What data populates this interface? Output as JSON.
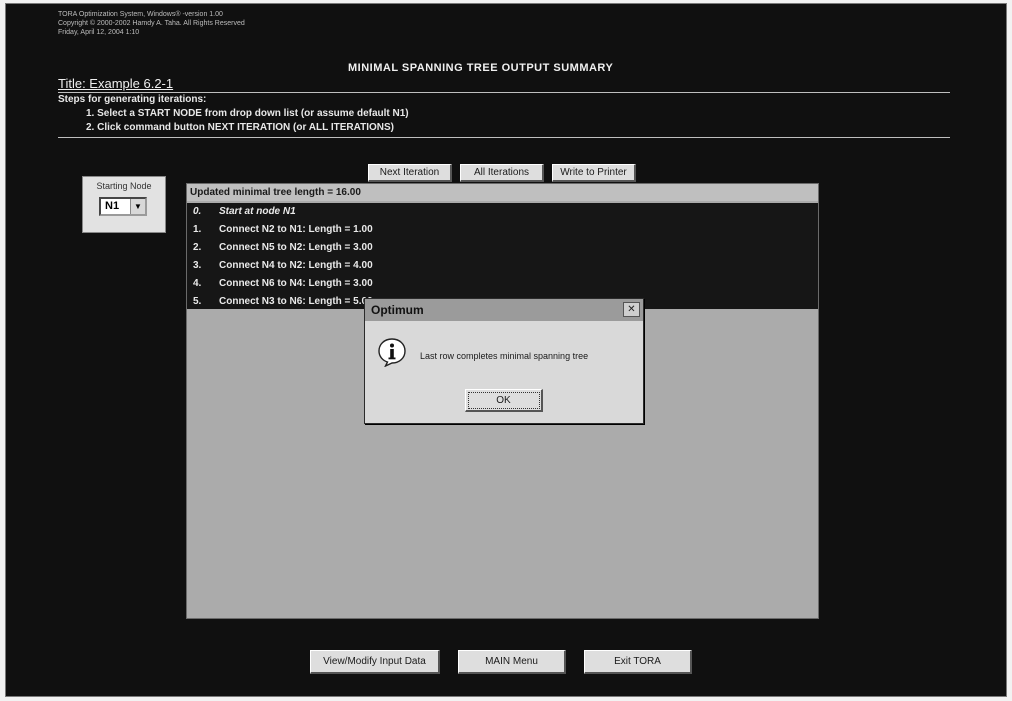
{
  "window": {
    "copyright_lines": [
      "TORA Optimization System, Windows® -version 1.00",
      "Copyright © 2000-2002 Hamdy A. Taha. All Rights Reserved",
      "Friday, April 12, 2004  1:10"
    ],
    "main_title": "MINIMAL SPANNING TREE OUTPUT SUMMARY",
    "title_line": "Title: Example 6.2-1"
  },
  "instructions": {
    "heading": "Steps for generating iterations:",
    "steps": [
      "1.  Select a START NODE from drop down list (or assume default N1)",
      "2.  Click command button NEXT ITERATION (or ALL ITERATIONS)"
    ]
  },
  "toolbar": {
    "next_iteration": "Next Iteration",
    "all_iterations": "All Iterations",
    "write_to_printer": "Write to Printer"
  },
  "starting_node": {
    "label": "Starting Node",
    "selected": "N1"
  },
  "results": {
    "header": "Updated minimal tree length = 16.00",
    "rows": [
      {
        "num": "0.",
        "text": "Start at node N1"
      },
      {
        "num": "1.",
        "text": "Connect N2 to N1: Length = 1.00"
      },
      {
        "num": "2.",
        "text": "Connect N5 to N2: Length = 3.00"
      },
      {
        "num": "3.",
        "text": "Connect N4 to N2: Length = 4.00"
      },
      {
        "num": "4.",
        "text": "Connect N6 to N4: Length = 3.00"
      },
      {
        "num": "5.",
        "text": "Connect N3 to N6: Length = 5.00"
      }
    ]
  },
  "dialog": {
    "title": "Optimum",
    "close": "✕",
    "message": "Last row completes minimal spanning tree",
    "ok": "OK",
    "icon": "info-icon"
  },
  "bottom_buttons": {
    "view_modify": "View/Modify Input Data",
    "main_menu": "MAIN Menu",
    "exit": "Exit TORA"
  },
  "colors": {
    "screen_bg": "#101010",
    "panel_bg": "#ababab",
    "list_bg": "#161616",
    "button_face": "#dedede"
  }
}
